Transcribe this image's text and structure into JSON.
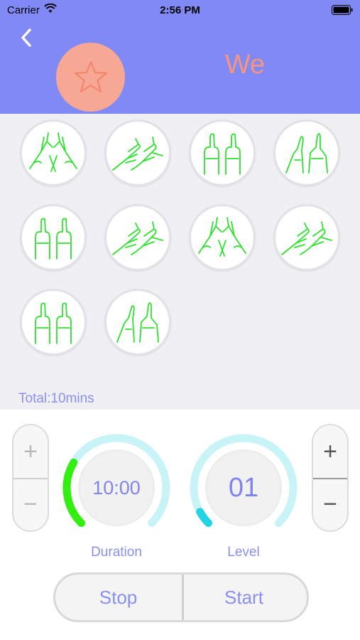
{
  "status_bar": {
    "carrier": "Carrier",
    "time": "2:56 PM"
  },
  "header": {
    "title": "We",
    "back_icon": "chevron-left-icon",
    "favorite_icon": "star-icon"
  },
  "colors": {
    "header_bg": "#8189f4",
    "accent_text": "#8a90ee",
    "hand_stroke": "#2fe12f",
    "duration_arc": "#33ee11",
    "level_arc": "#22d3e3",
    "dial_track": "#c9f4f7",
    "favorite_bg": "#f7a894"
  },
  "massage_modes": [
    {
      "icon": "hands-crossed-icon"
    },
    {
      "icon": "hands-tapping-icon"
    },
    {
      "icon": "hands-thumbs-up-icon"
    },
    {
      "icon": "hands-pointing-icon"
    },
    {
      "icon": "hands-thumbs-up-icon"
    },
    {
      "icon": "hands-tapping-icon"
    },
    {
      "icon": "hands-crossed-icon"
    },
    {
      "icon": "hands-tapping-icon"
    },
    {
      "icon": "hands-thumbs-up-icon"
    },
    {
      "icon": "hands-pointing-icon"
    }
  ],
  "total": "Total:10mins",
  "duration": {
    "value": "10:00",
    "label": "Duration",
    "fraction": 0.28
  },
  "level": {
    "value": "01",
    "label": "Level",
    "fraction": 0.06
  },
  "stepper": {
    "plus": "+",
    "minus": "−"
  },
  "actions": {
    "stop": "Stop",
    "start": "Start"
  }
}
